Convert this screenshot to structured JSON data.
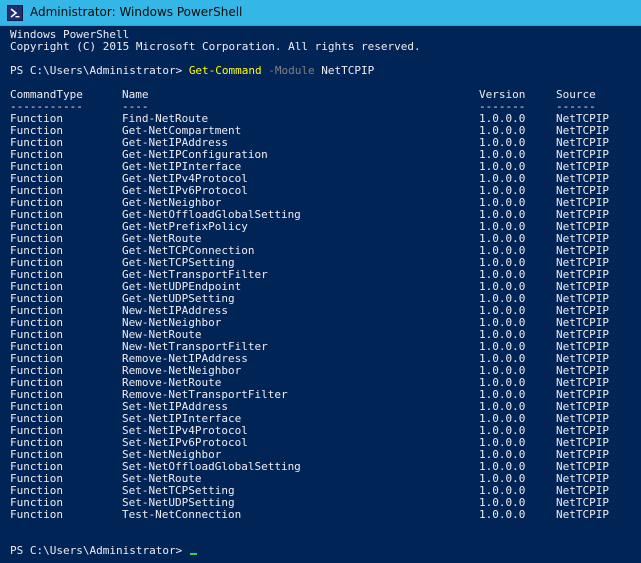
{
  "window": {
    "title": "Administrator: Windows PowerShell"
  },
  "header": {
    "line1": "Windows PowerShell",
    "line2": "Copyright (C) 2015 Microsoft Corporation. All rights reserved."
  },
  "command": {
    "prompt": "PS C:\\Users\\Administrator> ",
    "cmdlet": "Get-Command",
    "parameter": "-Module",
    "argument": "NetTCPIP"
  },
  "table": {
    "headers": [
      "CommandType",
      "Name",
      "Version",
      "Source"
    ],
    "underlines": [
      "-----------",
      "----",
      "-------",
      "------"
    ],
    "rows": [
      [
        "Function",
        "Find-NetRoute",
        "1.0.0.0",
        "NetTCPIP"
      ],
      [
        "Function",
        "Get-NetCompartment",
        "1.0.0.0",
        "NetTCPIP"
      ],
      [
        "Function",
        "Get-NetIPAddress",
        "1.0.0.0",
        "NetTCPIP"
      ],
      [
        "Function",
        "Get-NetIPConfiguration",
        "1.0.0.0",
        "NetTCPIP"
      ],
      [
        "Function",
        "Get-NetIPInterface",
        "1.0.0.0",
        "NetTCPIP"
      ],
      [
        "Function",
        "Get-NetIPv4Protocol",
        "1.0.0.0",
        "NetTCPIP"
      ],
      [
        "Function",
        "Get-NetIPv6Protocol",
        "1.0.0.0",
        "NetTCPIP"
      ],
      [
        "Function",
        "Get-NetNeighbor",
        "1.0.0.0",
        "NetTCPIP"
      ],
      [
        "Function",
        "Get-NetOffloadGlobalSetting",
        "1.0.0.0",
        "NetTCPIP"
      ],
      [
        "Function",
        "Get-NetPrefixPolicy",
        "1.0.0.0",
        "NetTCPIP"
      ],
      [
        "Function",
        "Get-NetRoute",
        "1.0.0.0",
        "NetTCPIP"
      ],
      [
        "Function",
        "Get-NetTCPConnection",
        "1.0.0.0",
        "NetTCPIP"
      ],
      [
        "Function",
        "Get-NetTCPSetting",
        "1.0.0.0",
        "NetTCPIP"
      ],
      [
        "Function",
        "Get-NetTransportFilter",
        "1.0.0.0",
        "NetTCPIP"
      ],
      [
        "Function",
        "Get-NetUDPEndpoint",
        "1.0.0.0",
        "NetTCPIP"
      ],
      [
        "Function",
        "Get-NetUDPSetting",
        "1.0.0.0",
        "NetTCPIP"
      ],
      [
        "Function",
        "New-NetIPAddress",
        "1.0.0.0",
        "NetTCPIP"
      ],
      [
        "Function",
        "New-NetNeighbor",
        "1.0.0.0",
        "NetTCPIP"
      ],
      [
        "Function",
        "New-NetRoute",
        "1.0.0.0",
        "NetTCPIP"
      ],
      [
        "Function",
        "New-NetTransportFilter",
        "1.0.0.0",
        "NetTCPIP"
      ],
      [
        "Function",
        "Remove-NetIPAddress",
        "1.0.0.0",
        "NetTCPIP"
      ],
      [
        "Function",
        "Remove-NetNeighbor",
        "1.0.0.0",
        "NetTCPIP"
      ],
      [
        "Function",
        "Remove-NetRoute",
        "1.0.0.0",
        "NetTCPIP"
      ],
      [
        "Function",
        "Remove-NetTransportFilter",
        "1.0.0.0",
        "NetTCPIP"
      ],
      [
        "Function",
        "Set-NetIPAddress",
        "1.0.0.0",
        "NetTCPIP"
      ],
      [
        "Function",
        "Set-NetIPInterface",
        "1.0.0.0",
        "NetTCPIP"
      ],
      [
        "Function",
        "Set-NetIPv4Protocol",
        "1.0.0.0",
        "NetTCPIP"
      ],
      [
        "Function",
        "Set-NetIPv6Protocol",
        "1.0.0.0",
        "NetTCPIP"
      ],
      [
        "Function",
        "Set-NetNeighbor",
        "1.0.0.0",
        "NetTCPIP"
      ],
      [
        "Function",
        "Set-NetOffloadGlobalSetting",
        "1.0.0.0",
        "NetTCPIP"
      ],
      [
        "Function",
        "Set-NetRoute",
        "1.0.0.0",
        "NetTCPIP"
      ],
      [
        "Function",
        "Set-NetTCPSetting",
        "1.0.0.0",
        "NetTCPIP"
      ],
      [
        "Function",
        "Set-NetUDPSetting",
        "1.0.0.0",
        "NetTCPIP"
      ],
      [
        "Function",
        "Test-NetConnection",
        "1.0.0.0",
        "NetTCPIP"
      ]
    ]
  },
  "final_prompt": "PS C:\\Users\\Administrator> ",
  "icons": {
    "app_icon": "powershell-icon",
    "cursor": "cursor-icon"
  },
  "colors": {
    "console_background": "#012456",
    "console_text": "#eeedf0",
    "titlebar": "#34b7e6",
    "cmdlet": "#ffff00",
    "parameter": "#808080",
    "cursor": "#39d353"
  }
}
